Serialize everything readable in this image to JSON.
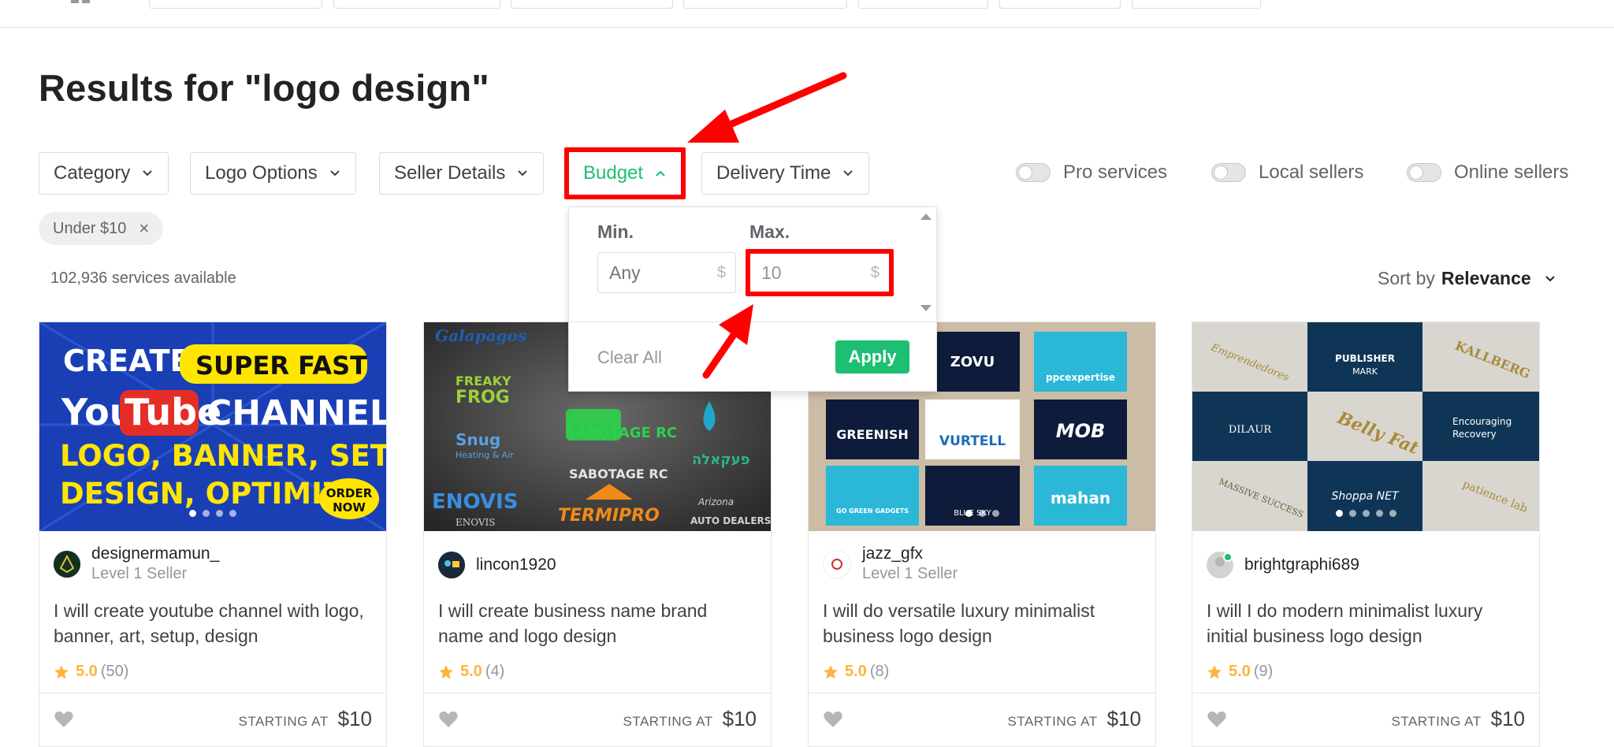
{
  "page": {
    "title": "Results for \"logo design\"",
    "count": "102,936 services available"
  },
  "filters": [
    {
      "label": "Category"
    },
    {
      "label": "Logo Options"
    },
    {
      "label": "Seller Details"
    },
    {
      "label": "Budget"
    },
    {
      "label": "Delivery Time"
    }
  ],
  "toggles": [
    {
      "label": "Pro services"
    },
    {
      "label": "Local sellers"
    },
    {
      "label": "Online sellers"
    }
  ],
  "active_tag": {
    "label": "Under $10",
    "remove": "×"
  },
  "sort": {
    "label": "Sort by",
    "value": "Relevance"
  },
  "budget_dropdown": {
    "min_label": "Min.",
    "min_placeholder": "Any",
    "max_label": "Max.",
    "max_value": "10",
    "currency": "$",
    "clear_label": "Clear All",
    "apply_label": "Apply"
  },
  "colors": {
    "accent": "#1dbf73",
    "highlight": "#ff0000",
    "star": "#ffb33e"
  },
  "thumbs": {
    "t1": {
      "l1": "CREATE,",
      "badge": "SUPER FAST",
      "you": "You",
      "tube": "Tube",
      "channel": "CHANNEL",
      "l3": "LOGO, BANNER, SETUP,",
      "l4": "DESIGN, OPTIMIZE,",
      "order1": "ORDER",
      "order2": "NOW"
    },
    "t2": {
      "l1": "Galapagos",
      "l2": "FREAKY",
      "l3": "FROG",
      "l4": "Snug",
      "l5": "Heating & Air",
      "l6": "ENOVIS",
      "l7": "TERMIPRO",
      "l8": "SABOTAGE RC",
      "l9": "פעקאלה",
      "l10": "AUTO DEALERS",
      "l11": "Arizona",
      "l12": "ENOVIS"
    },
    "t3": {
      "a": "ZOVU",
      "b": "ppcexpertise",
      "c": "GREENISH",
      "d": "VURTELL",
      "e": "MOB",
      "f": "GO GREEN GADGETS",
      "g": "BLUE SKY",
      "h": "mahan"
    },
    "t4": {
      "a": "Emprendedores",
      "b": "PUBLISHER",
      "c": "MARK",
      "d": "KALLBERG",
      "e": "DILAUR",
      "f": "Belly Fat",
      "g": "Encouraging",
      "h": "Recovery",
      "i": "MASSIVE SUCCESS",
      "j": "Shoppa NET",
      "k": "patience lab"
    }
  },
  "cards": [
    {
      "seller": "designermamun_",
      "level": "Level 1 Seller",
      "title": "I will create youtube channel with logo, banner, art, setup, design",
      "score": "5.0",
      "reviews": "(50)",
      "price_label": "STARTING AT",
      "price": "$10"
    },
    {
      "seller": "lincon1920",
      "level": "",
      "title": "I will create business name brand name and logo design",
      "score": "5.0",
      "reviews": "(4)",
      "price_label": "STARTING AT",
      "price": "$10"
    },
    {
      "seller": "jazz_gfx",
      "level": "Level 1 Seller",
      "title": "I will do versatile luxury minimalist business logo design",
      "score": "5.0",
      "reviews": "(8)",
      "price_label": "STARTING AT",
      "price": "$10"
    },
    {
      "seller": "brightgraphi689",
      "level": "",
      "title": "I will I do modern minimalist luxury initial business logo design",
      "score": "5.0",
      "reviews": "(9)",
      "price_label": "STARTING AT",
      "price": "$10"
    }
  ]
}
